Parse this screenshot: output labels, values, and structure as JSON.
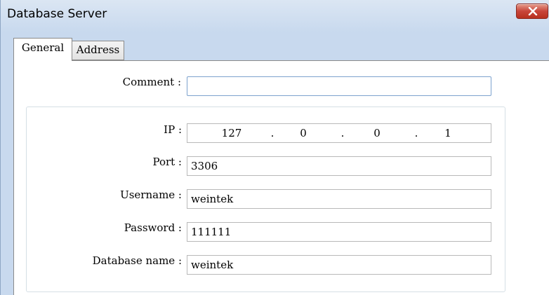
{
  "window": {
    "title": "Database Server",
    "close_symbol": "×"
  },
  "tabs": [
    {
      "label": "General",
      "active": true
    },
    {
      "label": "Address",
      "active": false
    }
  ],
  "general": {
    "comment": {
      "label": "Comment :",
      "value": ""
    },
    "ip": {
      "label": "IP :",
      "octets": [
        "127",
        "0",
        "0",
        "1"
      ],
      "separator": "."
    },
    "port": {
      "label": "Port :",
      "value": "3306"
    },
    "username": {
      "label": "Username :",
      "value": "weintek"
    },
    "password": {
      "label": "Password :",
      "value": "111111"
    },
    "database_name": {
      "label": "Database name :",
      "value": "weintek"
    }
  },
  "colors": {
    "title_bg": "#c8d9ee",
    "close_button": "#c8453a",
    "focus_border": "#7da2ce"
  },
  "icons": {
    "close": "close-icon"
  }
}
